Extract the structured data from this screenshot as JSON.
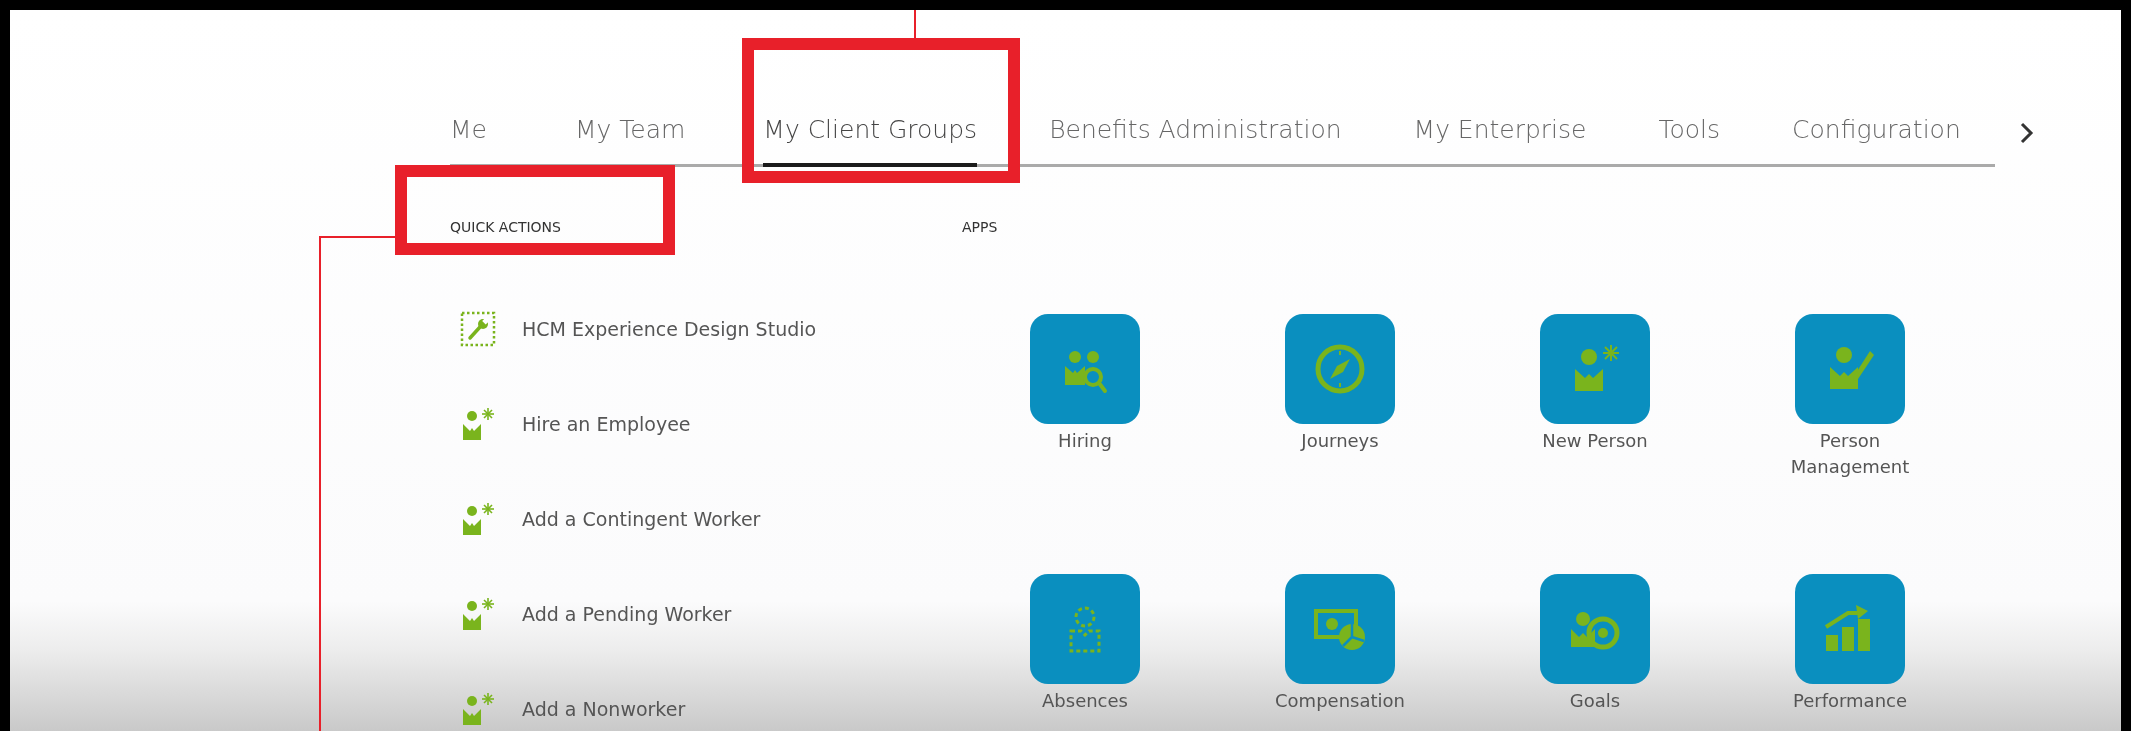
{
  "tabs": [
    {
      "label": "Me",
      "selected": false
    },
    {
      "label": "My Team",
      "selected": false
    },
    {
      "label": "My Client Groups",
      "selected": true
    },
    {
      "label": "Benefits Administration",
      "selected": false
    },
    {
      "label": "My Enterprise",
      "selected": false
    },
    {
      "label": "Tools",
      "selected": false
    },
    {
      "label": "Configuration",
      "selected": false
    }
  ],
  "quick_actions": {
    "title": "QUICK ACTIONS",
    "items": [
      {
        "label": "HCM Experience Design Studio"
      },
      {
        "label": "Hire an Employee"
      },
      {
        "label": "Add a Contingent Worker"
      },
      {
        "label": "Add a Pending Worker"
      },
      {
        "label": "Add a Nonworker"
      }
    ]
  },
  "apps": {
    "title": "APPS",
    "items": [
      {
        "label": "Hiring"
      },
      {
        "label": "Journeys"
      },
      {
        "label": "New Person"
      },
      {
        "label": "Person Management"
      },
      {
        "label": "Absences"
      },
      {
        "label": "Compensation"
      },
      {
        "label": "Goals"
      },
      {
        "label": "Performance"
      }
    ]
  }
}
